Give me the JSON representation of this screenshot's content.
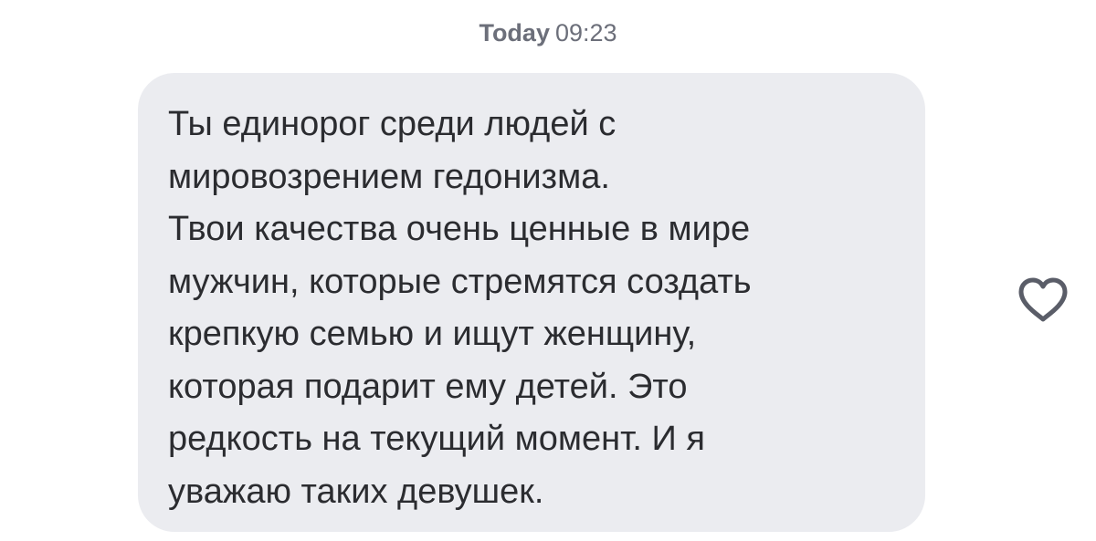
{
  "timestamp": {
    "day": "Today",
    "time": "09:23"
  },
  "message": {
    "lines": [
      "Ты единорог среди людей с",
      "мировозрением гедонизма.",
      "Твои качества очень ценные в мире",
      "мужчин, которые стремятся создать",
      "крепкую семью и ищут женщину,",
      "которая подарит ему детей. Это",
      "редкость на текущий момент. И я",
      "уважаю таких девушек."
    ]
  },
  "like": {
    "icon": "heart-outline-icon",
    "color": "#5a5d68"
  },
  "colors": {
    "bubble": "#ebecf0",
    "text": "#2b2c30",
    "timestamp": "#6c6f7a"
  }
}
